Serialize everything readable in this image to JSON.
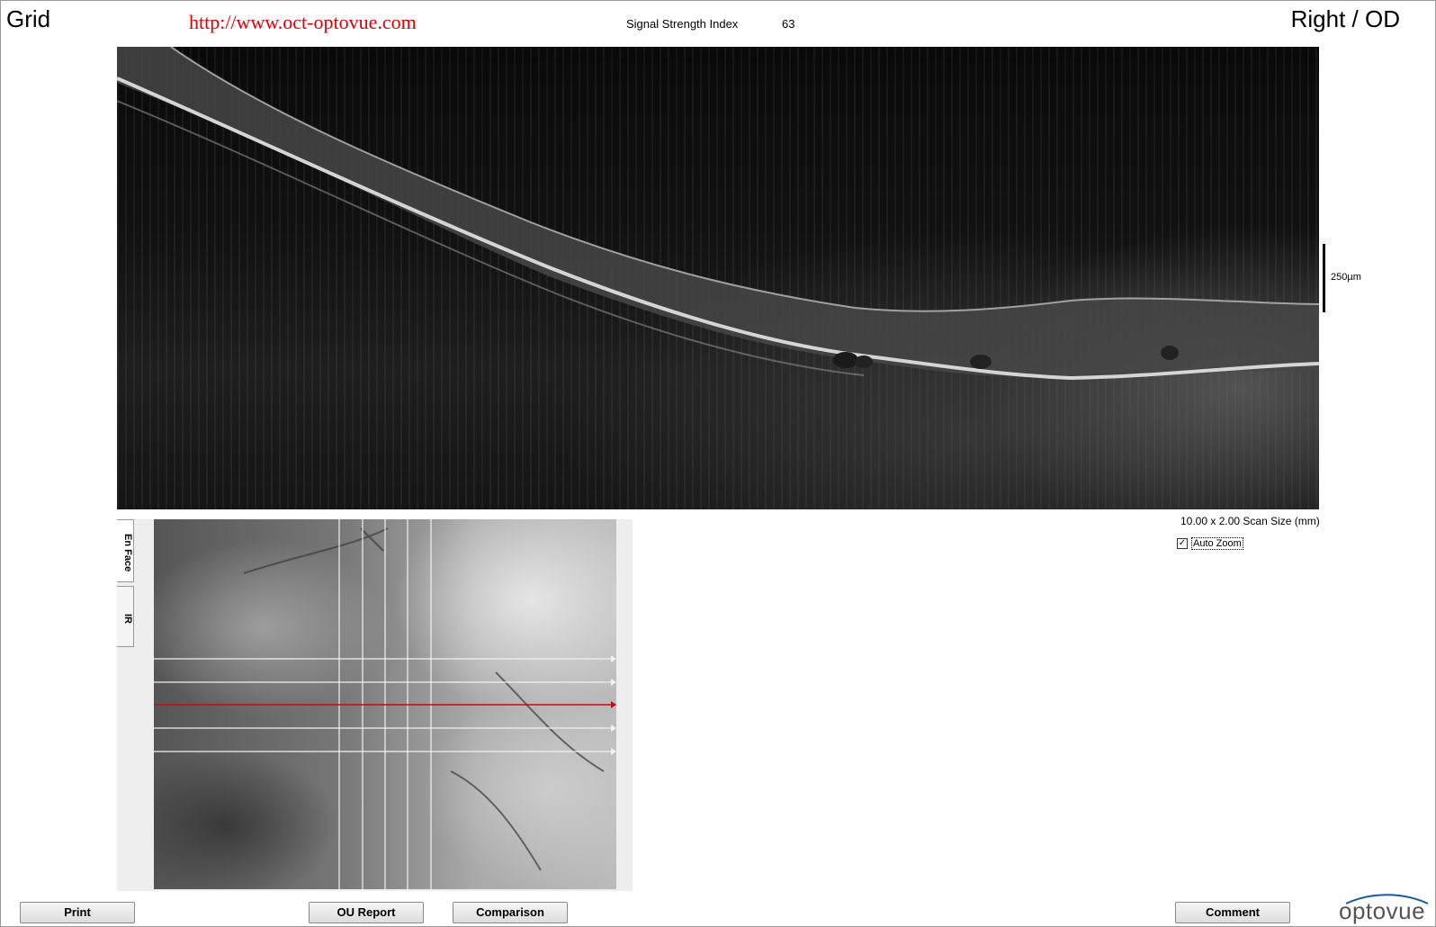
{
  "header": {
    "left_title": "Grid",
    "right_title": "Right / OD",
    "url": "http://www.oct-optovue.com",
    "signal_strength_label": "Signal Strength Index",
    "signal_strength_value": "63"
  },
  "bscan": {
    "scale_label": "250µm",
    "scan_size": "10.00 x 2.00 Scan Size (mm)",
    "auto_zoom_label": "Auto Zoom",
    "auto_zoom_checked": true
  },
  "enface": {
    "tabs": [
      "En Face",
      "IR"
    ],
    "active_tab": "En Face",
    "selected_line_color": "#e00000"
  },
  "buttons": {
    "print": "Print",
    "ou_report": "OU Report",
    "comparison": "Comparison",
    "comment": "Comment"
  },
  "logo": {
    "text": "optovue",
    "icon": "eye-logo-icon"
  }
}
